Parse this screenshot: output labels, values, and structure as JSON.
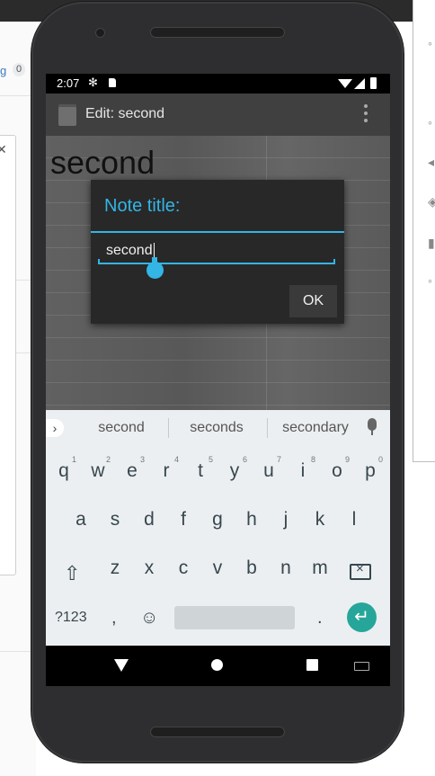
{
  "background": {
    "tag_text": "g",
    "tag_count": "0"
  },
  "status_bar": {
    "time": "2:07",
    "settings_icon": "gear-icon",
    "sd_icon": "sd-card-icon"
  },
  "app_bar": {
    "title": "Edit: second",
    "app_icon": "notepad-icon",
    "menu_icon": "overflow-menu-icon"
  },
  "note": {
    "text": "second"
  },
  "dialog": {
    "title": "Note title:",
    "input_value": "second",
    "ok_label": "OK"
  },
  "keyboard": {
    "suggestions": [
      "second",
      "seconds",
      "secondary"
    ],
    "row1": [
      "q",
      "w",
      "e",
      "r",
      "t",
      "y",
      "u",
      "i",
      "o",
      "p"
    ],
    "row1_hints": [
      "1",
      "2",
      "3",
      "4",
      "5",
      "6",
      "7",
      "8",
      "9",
      "0"
    ],
    "row2": [
      "a",
      "s",
      "d",
      "f",
      "g",
      "h",
      "j",
      "k",
      "l"
    ],
    "row3": [
      "z",
      "x",
      "c",
      "v",
      "b",
      "n",
      "m"
    ],
    "symbols_label": "?123",
    "comma": ",",
    "period": ".",
    "accent_color": "#26a69a"
  },
  "colors": {
    "holo_blue": "#33b5e5"
  }
}
